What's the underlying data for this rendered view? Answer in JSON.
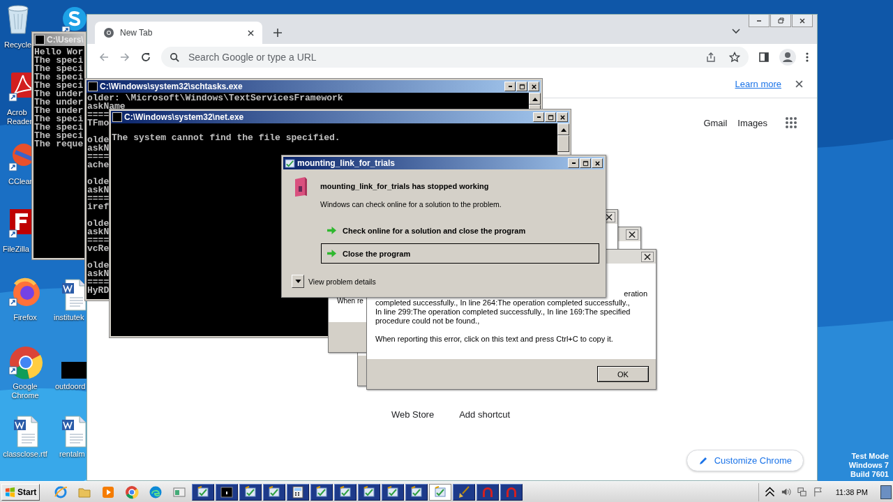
{
  "desktop": {
    "icons": [
      {
        "kind": "recycle",
        "label": "Recycle"
      },
      {
        "kind": "skype"
      },
      {
        "kind": "acrobat",
        "label": "Acrob\nReader"
      },
      {
        "kind": "ccleaner",
        "label": "CClear"
      },
      {
        "kind": "filezilla",
        "label": "FileZilla"
      },
      {
        "kind": "firefox",
        "label": "Firefox"
      },
      {
        "kind": "word",
        "label": "institutek"
      },
      {
        "kind": "chrome",
        "label": "Google\nChrome"
      },
      {
        "kind": "blank",
        "label": "outdoord"
      },
      {
        "kind": "word",
        "label": "classclose.rtf"
      },
      {
        "kind": "word",
        "label": "rentalm"
      }
    ],
    "system_notice": [
      "Test Mode",
      "Windows 7",
      "Build 7601"
    ]
  },
  "chrome": {
    "tab": {
      "title": "New Tab"
    },
    "omnibox": {
      "placeholder": "Search Google or type a URL"
    },
    "infobar": {
      "link": "Learn more"
    },
    "header_links": [
      "Gmail",
      "Images"
    ],
    "shortcuts": [
      "Web Store",
      "Add shortcut"
    ],
    "customize": "Customize Chrome"
  },
  "consoles": [
    {
      "title": "C:\\Users\\",
      "active": false,
      "blocks": [
        [
          "Hello Wor",
          "The speci",
          "The speci",
          "The speci",
          "The speci",
          "The under",
          "The under",
          "The under",
          "The speci",
          "The speci",
          "The speci",
          "The reque"
        ]
      ]
    },
    {
      "title": "C:\\Windows\\system32\\schtasks.exe",
      "active": true,
      "blocks": [
        [
          "older: \\Microsoft\\Windows\\TextServicesFramework",
          "askName",
          "====",
          "TFmo"
        ],
        [
          "olde",
          "askN",
          "====",
          "ache"
        ],
        [
          "olde",
          "askN",
          "====",
          "iref"
        ],
        [
          "olde",
          "askN",
          "====",
          "vcRe"
        ],
        [
          "olde",
          "askN",
          "====",
          "HyRD"
        ]
      ]
    },
    {
      "title": "C:\\Windows\\system32\\net.exe",
      "active": true,
      "blocks": [
        [
          "The system cannot find the file specified."
        ]
      ]
    }
  ],
  "error_reports": [
    {
      "kind": "partial",
      "text": "When re"
    },
    {
      "kind": "blank"
    },
    {
      "kind": "full",
      "fragment": "eration",
      "paragraphs": [
        [
          "completed successfully., In line 264:The operation completed successfully.,",
          "In line 299:The operation completed successfully., In line 169:The specified",
          "procedure could not be found.,"
        ],
        [
          "When reporting this error, click on this text and press Ctrl+C to copy it."
        ]
      ],
      "button": "OK"
    }
  ],
  "crash_dialog": {
    "title": "mounting_link_for_trials",
    "heading": "mounting_link_for_trials has stopped working",
    "message": "Windows can check online for a solution to the problem.",
    "options": [
      {
        "label": "Check online for a solution and close the program",
        "selected": false
      },
      {
        "label": "Close the program",
        "selected": true
      }
    ],
    "details": "View problem details"
  },
  "taskbar": {
    "start": "Start",
    "items": [
      {
        "kind": "ie",
        "selected": false
      },
      {
        "kind": "folder",
        "selected": false
      },
      {
        "kind": "media",
        "selected": false
      },
      {
        "kind": "chrome",
        "selected": false
      },
      {
        "kind": "edge",
        "selected": false
      },
      {
        "kind": "window",
        "selected": false
      },
      {
        "kind": "wer",
        "selected": false
      },
      {
        "kind": "console",
        "selected": false
      },
      {
        "kind": "wer",
        "selected": false
      },
      {
        "kind": "wer",
        "selected": false
      },
      {
        "kind": "calc",
        "selected": false
      },
      {
        "kind": "wer",
        "selected": false
      },
      {
        "kind": "wer",
        "selected": false
      },
      {
        "kind": "wer",
        "selected": false
      },
      {
        "kind": "wer",
        "selected": false
      },
      {
        "kind": "wer",
        "selected": false
      },
      {
        "kind": "wer",
        "selected": true
      },
      {
        "kind": "broom",
        "selected": false
      },
      {
        "kind": "arch",
        "selected": false
      },
      {
        "kind": "arch",
        "selected": false
      }
    ],
    "clock": "11:38 PM"
  }
}
